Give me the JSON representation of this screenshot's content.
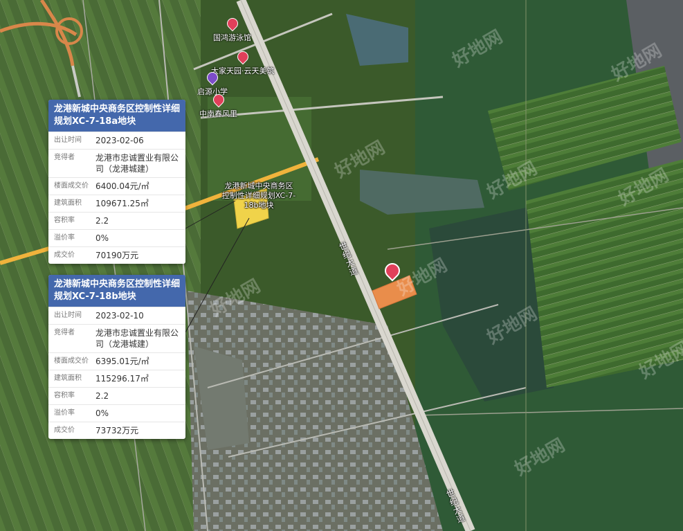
{
  "map": {
    "poi": {
      "gym": "国鸿游泳馆",
      "resort": "大家天园·云天美筑",
      "school": "启源小学",
      "residence": "中南春风里"
    },
    "road": {
      "upper": "世纪大道",
      "lower": "世纪大道"
    },
    "parcel_label": "龙港新城中央商务区控制性详细规划XC-7-18b地块",
    "watermark": "好地网"
  },
  "cards": [
    {
      "title": "龙港新城中央商务区控制性详细规划XC-7-18a地块",
      "rows": [
        {
          "k": "出让时间",
          "v": "2023-02-06"
        },
        {
          "k": "竞得者",
          "v": "龙港市忠诚置业有限公司（龙港城建）"
        },
        {
          "k": "楼面成交价",
          "v": "6400.04元/㎡"
        },
        {
          "k": "建筑面积",
          "v": "109671.25㎡"
        },
        {
          "k": "容积率",
          "v": "2.2"
        },
        {
          "k": "溢价率",
          "v": "0%"
        },
        {
          "k": "成交价",
          "v": "70190万元"
        }
      ]
    },
    {
      "title": "龙港新城中央商务区控制性详细规划XC-7-18b地块",
      "rows": [
        {
          "k": "出让时间",
          "v": "2023-02-10"
        },
        {
          "k": "竞得者",
          "v": "龙港市忠诚置业有限公司（龙港城建）"
        },
        {
          "k": "楼面成交价",
          "v": "6395.01元/㎡"
        },
        {
          "k": "建筑面积",
          "v": "115296.17㎡"
        },
        {
          "k": "容积率",
          "v": "2.2"
        },
        {
          "k": "溢价率",
          "v": "0%"
        },
        {
          "k": "成交价",
          "v": "73732万元"
        }
      ]
    }
  ]
}
